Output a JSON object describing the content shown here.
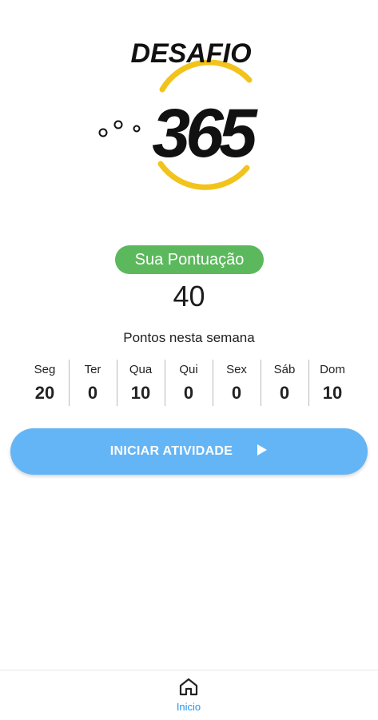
{
  "logo": {
    "word": "DESAFIO",
    "number": "365"
  },
  "score": {
    "label": "Sua Pontuação",
    "value": "40"
  },
  "week": {
    "title": "Pontos nesta semana",
    "days": [
      {
        "name": "Seg",
        "points": "20"
      },
      {
        "name": "Ter",
        "points": "0"
      },
      {
        "name": "Qua",
        "points": "10"
      },
      {
        "name": "Qui",
        "points": "0"
      },
      {
        "name": "Sex",
        "points": "0"
      },
      {
        "name": "Sáb",
        "points": "0"
      },
      {
        "name": "Dom",
        "points": "10"
      }
    ]
  },
  "actions": {
    "start_label": "INICIAR ATIVIDADE",
    "start_icon": "play-icon"
  },
  "nav": {
    "home_label": "Inicio",
    "home_icon": "home-icon"
  },
  "colors": {
    "badge": "#5cb85c",
    "button": "#64b5f6",
    "nav_active": "#2196f3",
    "logo_ring": "#f2c31b"
  }
}
